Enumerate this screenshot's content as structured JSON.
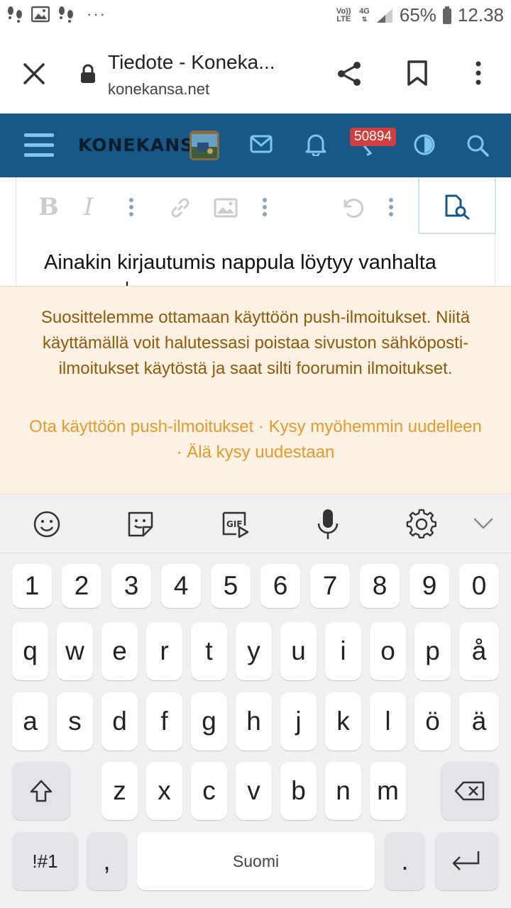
{
  "status_bar": {
    "network_volte": "Vo)) LTE",
    "network_4g": "4G",
    "battery": "65%",
    "time": "12.38"
  },
  "browser": {
    "title": "Tiedote - Koneka...",
    "url": "konekansa.net",
    "icons": [
      "close-icon",
      "lock-icon",
      "share-icon",
      "bookmark-icon",
      "more-vert-icon"
    ]
  },
  "site_header": {
    "logo": "KONEKANSA",
    "badge_count": "50894",
    "colors": {
      "header_bg": "#185886",
      "badge_bg": "#d13f3f"
    }
  },
  "editor": {
    "text": "Ainakin kirjautumis nappula löytyy vanhalta"
  },
  "notice": {
    "message": "Suosittelemme ottamaan käyttöön push-ilmoitukset. Niitä käyttämällä voit halutessasi poistaa sivuston sähköposti-ilmoitukset käytöstä ja saat silti foorumin ilmoitukset.",
    "actions": [
      "Ota käyttöön push-ilmoitukset",
      "Kysy myöhemmin uudelleen",
      "Älä kysy uudestaan"
    ],
    "separator": "·"
  },
  "keyboard": {
    "row_numbers": [
      "1",
      "2",
      "3",
      "4",
      "5",
      "6",
      "7",
      "8",
      "9",
      "0"
    ],
    "row_1": [
      "q",
      "w",
      "e",
      "r",
      "t",
      "y",
      "u",
      "i",
      "o",
      "p",
      "å"
    ],
    "row_2": [
      "a",
      "s",
      "d",
      "f",
      "g",
      "h",
      "j",
      "k",
      "l",
      "ö",
      "ä"
    ],
    "row_3": [
      "z",
      "x",
      "c",
      "v",
      "b",
      "n",
      "m"
    ],
    "symbols": "!#1",
    "comma": ",",
    "space": "Suomi",
    "period": "."
  }
}
